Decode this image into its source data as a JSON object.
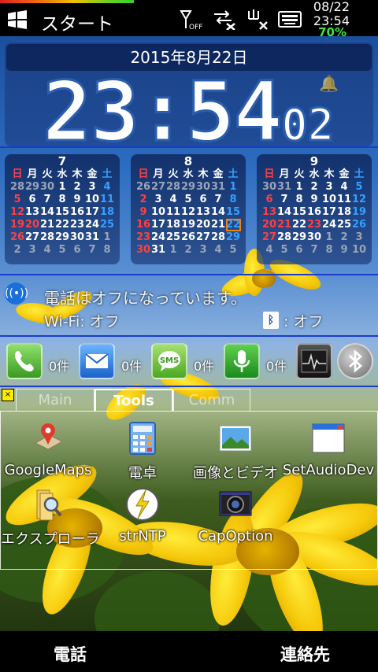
{
  "status_bar": {
    "start_label": "スタート",
    "date": "08/22",
    "time": "23:54",
    "battery": "70%",
    "icons": [
      "windows-logo",
      "signal-off-icon",
      "data-off-icon",
      "wifi-off-icon",
      "keyboard-icon"
    ]
  },
  "clock_widget": {
    "date": "2015年8月22日",
    "time_hm": "23:54",
    "time_sec": "02"
  },
  "calendars": [
    {
      "month": "7",
      "weekdays": [
        "日",
        "月",
        "火",
        "水",
        "木",
        "金",
        "土"
      ],
      "weeks": [
        [
          "28",
          "29",
          "30",
          "1",
          "2",
          "3",
          "4"
        ],
        [
          "5",
          "6",
          "7",
          "8",
          "9",
          "10",
          "11"
        ],
        [
          "12",
          "13",
          "14",
          "15",
          "16",
          "17",
          "18"
        ],
        [
          "19",
          "20",
          "21",
          "22",
          "23",
          "24",
          "25"
        ],
        [
          "26",
          "27",
          "28",
          "29",
          "30",
          "31",
          "1"
        ],
        [
          "2",
          "3",
          "4",
          "5",
          "6",
          "7",
          "8"
        ]
      ],
      "dim_first_week": 3,
      "dim_last_from_week": 4,
      "dim_last_from_day": 6,
      "red_extra": [
        "20"
      ]
    },
    {
      "month": "8",
      "weekdays": [
        "日",
        "月",
        "火",
        "水",
        "木",
        "金",
        "土"
      ],
      "weeks": [
        [
          "26",
          "27",
          "28",
          "29",
          "30",
          "31",
          "1"
        ],
        [
          "2",
          "3",
          "4",
          "5",
          "6",
          "7",
          "8"
        ],
        [
          "9",
          "10",
          "11",
          "12",
          "13",
          "14",
          "15"
        ],
        [
          "16",
          "17",
          "18",
          "19",
          "20",
          "21",
          "22"
        ],
        [
          "23",
          "24",
          "25",
          "26",
          "27",
          "28",
          "29"
        ],
        [
          "30",
          "31",
          "1",
          "2",
          "3",
          "4",
          "5"
        ]
      ],
      "dim_first_week": 6,
      "dim_last_from_week": 5,
      "dim_last_from_day": 2,
      "today": "22"
    },
    {
      "month": "9",
      "weekdays": [
        "日",
        "月",
        "火",
        "水",
        "木",
        "金",
        "土"
      ],
      "weeks": [
        [
          "30",
          "31",
          "1",
          "2",
          "3",
          "4",
          "5"
        ],
        [
          "6",
          "7",
          "8",
          "9",
          "10",
          "11",
          "12"
        ],
        [
          "13",
          "14",
          "15",
          "16",
          "17",
          "18",
          "19"
        ],
        [
          "20",
          "21",
          "22",
          "23",
          "24",
          "25",
          "26"
        ],
        [
          "27",
          "28",
          "29",
          "30",
          "1",
          "2",
          "3"
        ],
        [
          "4",
          "5",
          "6",
          "7",
          "8",
          "9",
          "10"
        ]
      ],
      "dim_first_week": 2,
      "dim_last_from_week": 4,
      "dim_last_from_day": 4,
      "red_extra": [
        "21",
        "23"
      ]
    }
  ],
  "phone_status": {
    "phone_off_text": "電話はオフになっています。",
    "wifi_text": "Wi-Fi: オフ",
    "bluetooth_text": ": オフ"
  },
  "quick_apps": [
    {
      "name": "phone",
      "count": "0件",
      "color": "#4fb83a"
    },
    {
      "name": "mail",
      "count": "0件",
      "color": "#2a7fe0"
    },
    {
      "name": "sms",
      "count": "0件",
      "color": "#6cc93a"
    },
    {
      "name": "voice",
      "count": "0件",
      "color": "#2aa030"
    },
    {
      "name": "monitor",
      "count": "",
      "color": "#333333"
    },
    {
      "name": "bluetooth",
      "count": "",
      "color": "#777777"
    }
  ],
  "tabs": [
    "Main",
    "Tools",
    "Comm"
  ],
  "active_tab": "Tools",
  "apps": [
    {
      "label": "GoogleMaps",
      "icon": "map-pin-icon"
    },
    {
      "label": "電卓",
      "icon": "calculator-icon"
    },
    {
      "label": "画像とビデオ",
      "icon": "picture-icon"
    },
    {
      "label": "SetAudioDev",
      "icon": "window-icon"
    },
    {
      "label": "エクスプローラ",
      "icon": "folder-search-icon"
    },
    {
      "label": "strNTP",
      "icon": "clock-bolt-icon"
    },
    {
      "label": "CapOption",
      "icon": "camera-icon"
    }
  ],
  "softkeys": {
    "left": "電話",
    "right": "連絡先"
  }
}
